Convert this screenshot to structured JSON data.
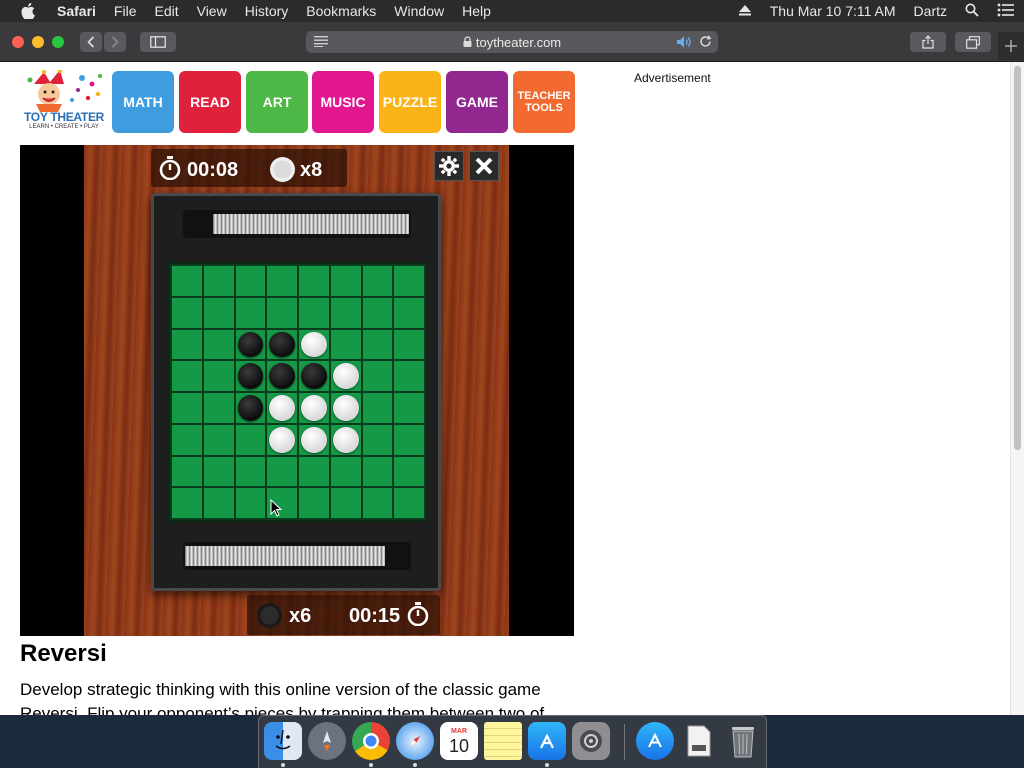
{
  "menubar": {
    "app": "Safari",
    "items": [
      "File",
      "Edit",
      "View",
      "History",
      "Bookmarks",
      "Window",
      "Help"
    ],
    "datetime": "Thu Mar 10  7:11 AM",
    "user": "Dartz"
  },
  "toolbar": {
    "url": "toytheater.com"
  },
  "site": {
    "logo_name": "TOY THEATER",
    "logo_tagline": "LEARN • CREATE • PLAY",
    "nav": [
      {
        "label": "MATH",
        "color": "#3f9ddf"
      },
      {
        "label": "READ",
        "color": "#e0213b"
      },
      {
        "label": "ART",
        "color": "#4db845"
      },
      {
        "label": "MUSIC",
        "color": "#e2168f"
      },
      {
        "label": "PUZZLE",
        "color": "#fbb418"
      },
      {
        "label": "GAME",
        "color": "#92278f"
      },
      {
        "label": "TEACHER TOOLS",
        "color": "#f26a2f"
      }
    ],
    "ad_label": "Advertisement"
  },
  "game": {
    "top_timer": "00:08",
    "top_count": "x8",
    "bottom_count": "x6",
    "bottom_timer": "00:15",
    "board": [
      "........",
      "........",
      "..BBW...",
      "..BBBW..",
      "..BWWW..",
      "...WWW..",
      "........",
      "........"
    ],
    "colors": {
      "board_green": "#149a47",
      "wood": "#9b4320"
    }
  },
  "content": {
    "title": "Reversi",
    "description": "Develop strategic thinking with this online version of the classic game Reversi. Flip your opponent’s pieces by trapping them between two of"
  },
  "dock": {
    "apps": [
      "finder-icon",
      "launchpad-icon",
      "chrome-icon",
      "safari-icon",
      "calendar-icon",
      "notes-icon",
      "app-store-icon",
      "system-preferences-icon",
      "app-store-download-icon",
      "document-icon",
      "trash-icon"
    ],
    "calendar_month": "MAR",
    "calendar_day": "10"
  }
}
